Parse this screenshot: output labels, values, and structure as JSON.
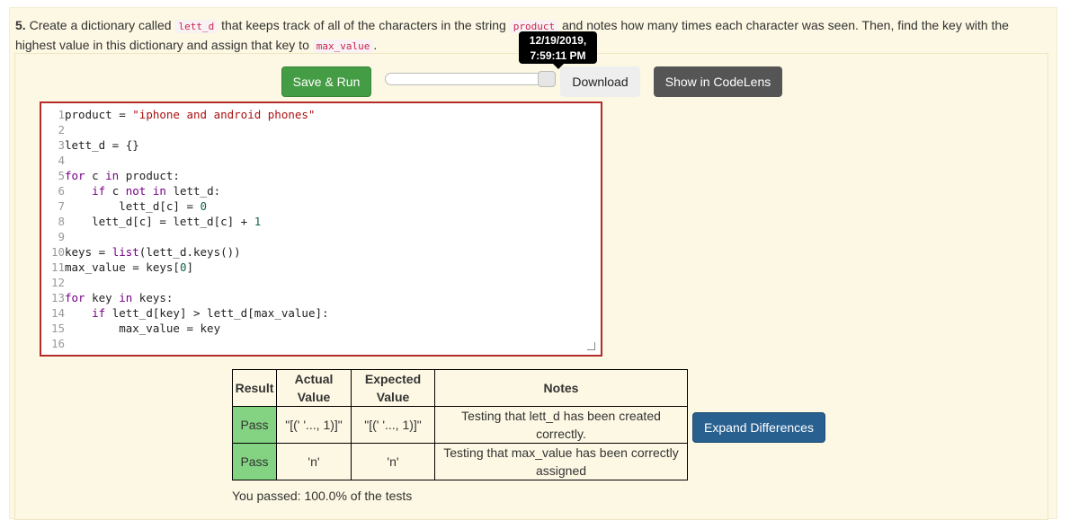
{
  "question": {
    "number": "5.",
    "text_1": " Create a dictionary called ",
    "code_1": "lett_d",
    "text_2": " that keeps track of all of the characters in the string ",
    "code_2": "product",
    "text_3": " and notes how many times each character was seen. Then, find the key with the highest value in this dictionary and assign that key to ",
    "code_3": "max_value",
    "text_4": "."
  },
  "toolbar": {
    "save_label": "Save & Run",
    "download_label": "Download",
    "codelens_label": "Show in CodeLens",
    "tooltip_date": "12/19/2019,",
    "tooltip_time": "7:59:11 PM",
    "history_slider_position": 1.0
  },
  "editor": {
    "lines": [
      "product = \"iphone and android phones\"",
      "",
      "lett_d = {}",
      "",
      "for c in product:",
      "    if c not in lett_d:",
      "        lett_d[c] = 0",
      "    lett_d[c] = lett_d[c] + 1",
      "",
      "keys = list(lett_d.keys())",
      "max_value = keys[0]",
      "",
      "for key in keys:",
      "    if lett_d[key] > lett_d[max_value]:",
      "        max_value = key",
      ""
    ]
  },
  "results": {
    "headers": {
      "result": "Result",
      "actual_1": "Actual",
      "actual_2": "Value",
      "expected_1": "Expected",
      "expected_2": "Value",
      "notes": "Notes"
    },
    "rows": [
      {
        "result": "Pass",
        "actual": "\"[(' '..., 1)]\"",
        "expected": "\"[(' '..., 1)]\"",
        "notes_1": "Testing that lett_d has been created",
        "notes_2": "correctly."
      },
      {
        "result": "Pass",
        "actual": "'n'",
        "expected": "'n'",
        "notes_1": "Testing that max_value has been correctly",
        "notes_2": "assigned"
      }
    ],
    "expand_label": "Expand Differences",
    "summary": "You passed: 100.0% of the tests"
  }
}
